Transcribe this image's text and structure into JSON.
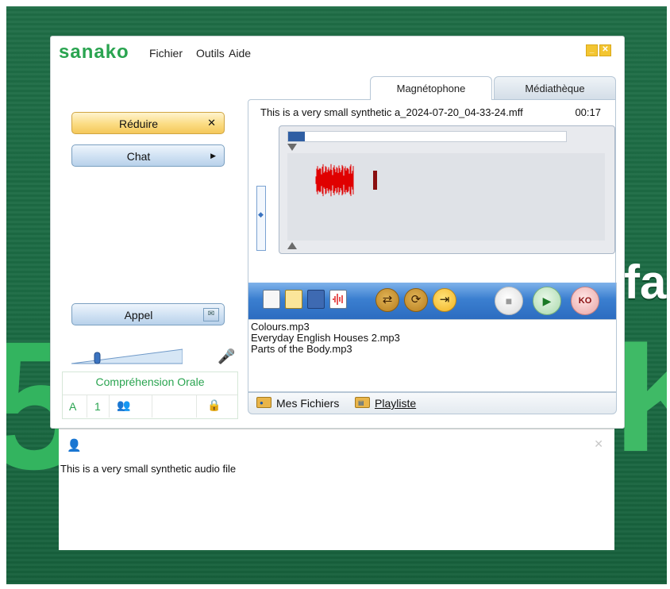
{
  "window": {
    "logo": "sanako",
    "menu": [
      "Fichier",
      "Outils",
      "Aide"
    ]
  },
  "left_panel": {
    "reduire_label": "Réduire",
    "reduire_icon": "✕",
    "chat_label": "Chat",
    "chat_icon": "▶",
    "appel_label": "Appel",
    "volume_level": 0.22,
    "section_title": "Compréhension Orale",
    "cell_a": "A",
    "cell_1": "1"
  },
  "recorder": {
    "tabs": [
      "Magnétophone",
      "Médiathèque"
    ],
    "active_tab": "Magnétophone",
    "filename": "This is a very small synthetic a_2024-07-20_04-33-24.mff",
    "duration": "00:17",
    "progress": 0.06,
    "wave_color": "#e00000"
  },
  "playlist": {
    "items": [
      "Colours.mp3",
      "Everyday English Houses 2.mp3",
      "Parts of the Body.mp3"
    ],
    "footer_mes_fichiers": "Mes Fichiers",
    "footer_playliste": "Playliste"
  },
  "popup": {
    "text": "This is a very small synthetic audio file",
    "close": "✕"
  },
  "colors": {
    "accent_green": "#2aa450",
    "toolbar_blue": "#2c6cc0",
    "background_green": "#1f6d46"
  }
}
